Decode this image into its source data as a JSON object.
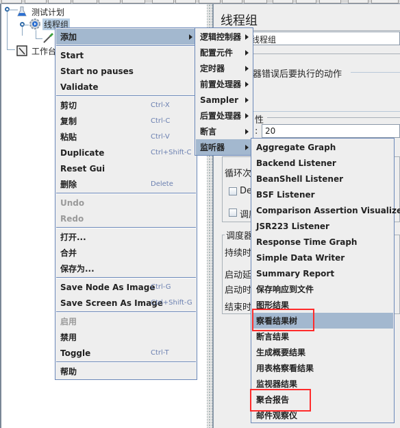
{
  "tree": {
    "items": [
      {
        "label": "测试计划",
        "icon": "flask-icon"
      },
      {
        "label": "线程组",
        "icon": "gear-icon",
        "selected": true
      },
      {
        "label": "",
        "icon": "dropper-icon"
      },
      {
        "label": "工作台",
        "icon": "notepad-icon"
      }
    ]
  },
  "right_panel": {
    "title": "线程组",
    "name_value": "线程组",
    "error_action_label": "器错误后要执行的动作",
    "thread_props_label": "性",
    "threads_label": ":",
    "threads_value": "20",
    "loop_label": "循环次",
    "delay_checkbox_label": "Del",
    "scheduler_checkbox_label": "调度",
    "scheduler_group_label": "调度器",
    "duration_label": "持续时",
    "startup_delay_label": "启动延",
    "start_time_label": "启动时",
    "end_time_label": "结束时"
  },
  "context_menu": {
    "items": [
      {
        "label": "添加",
        "submenu": true,
        "highlighted": true
      },
      {
        "sep": true
      },
      {
        "label": "Start"
      },
      {
        "label": "Start no pauses"
      },
      {
        "label": "Validate"
      },
      {
        "sep": true
      },
      {
        "label": "剪切",
        "shortcut": "Ctrl-X"
      },
      {
        "label": "复制",
        "shortcut": "Ctrl-C"
      },
      {
        "label": "粘贴",
        "shortcut": "Ctrl-V"
      },
      {
        "label": "Duplicate",
        "shortcut": "Ctrl+Shift-C"
      },
      {
        "label": "Reset Gui"
      },
      {
        "label": "删除",
        "shortcut": "Delete"
      },
      {
        "sep": true
      },
      {
        "label": "Undo",
        "disabled": true
      },
      {
        "label": "Redo",
        "disabled": true
      },
      {
        "sep": true
      },
      {
        "label": "打开..."
      },
      {
        "label": "合并"
      },
      {
        "label": "保存为..."
      },
      {
        "sep": true
      },
      {
        "label": "Save Node As Image",
        "shortcut": "Ctrl-G"
      },
      {
        "label": "Save Screen As Image",
        "shortcut": "Ctrl+Shift-G"
      },
      {
        "sep": true
      },
      {
        "label": "启用",
        "disabled": true
      },
      {
        "label": "禁用"
      },
      {
        "label": "Toggle",
        "shortcut": "Ctrl-T"
      },
      {
        "sep": true
      },
      {
        "label": "帮助"
      }
    ]
  },
  "add_submenu": {
    "items": [
      {
        "label": "逻辑控制器",
        "submenu": true
      },
      {
        "label": "配置元件",
        "submenu": true
      },
      {
        "label": "定时器",
        "submenu": true
      },
      {
        "label": "前置处理器",
        "submenu": true
      },
      {
        "label": "Sampler",
        "submenu": true
      },
      {
        "label": "后置处理器",
        "submenu": true
      },
      {
        "label": "断言",
        "submenu": true
      },
      {
        "label": "监听器",
        "submenu": true,
        "highlighted": true
      }
    ]
  },
  "listener_submenu": {
    "items": [
      {
        "label": "Aggregate Graph"
      },
      {
        "label": "Backend Listener"
      },
      {
        "label": "BeanShell Listener"
      },
      {
        "label": "BSF Listener"
      },
      {
        "label": "Comparison Assertion Visualizer"
      },
      {
        "label": "JSR223 Listener"
      },
      {
        "label": "Response Time Graph"
      },
      {
        "label": "Simple Data Writer"
      },
      {
        "label": "Summary Report"
      },
      {
        "label": "保存响应到文件"
      },
      {
        "label": "图形结果"
      },
      {
        "label": "察看结果树",
        "highlighted": true,
        "annotated": true
      },
      {
        "label": "断言结果"
      },
      {
        "label": "生成概要结果"
      },
      {
        "label": "用表格察看结果"
      },
      {
        "label": "监视器结果"
      },
      {
        "label": "聚合报告",
        "annotated": true
      },
      {
        "label": "邮件观察仪"
      }
    ]
  },
  "colors": {
    "highlight": "#a3b8cf",
    "menu_border": "#6a87b8",
    "shortcut": "#6a7fb0",
    "annotation": "#ff2a2a"
  }
}
